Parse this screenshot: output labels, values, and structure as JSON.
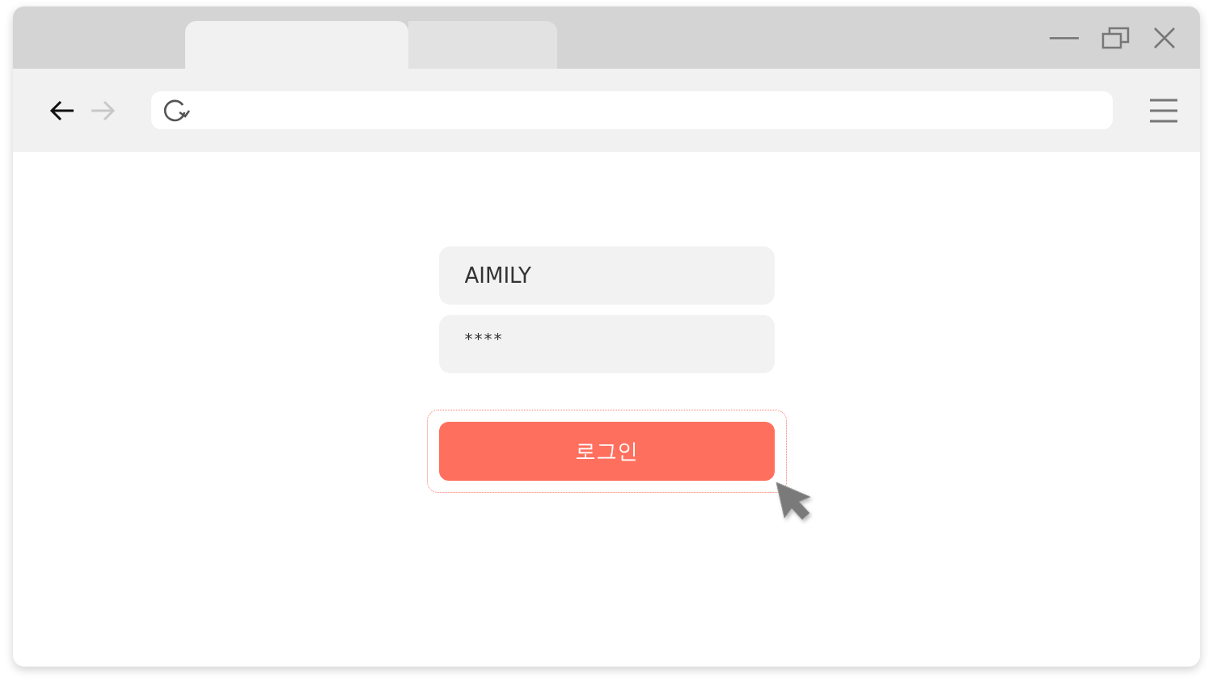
{
  "tabs": [
    {
      "selected": true
    },
    {
      "selected": false
    }
  ],
  "navigation": {
    "back_disabled": false,
    "forward_disabled": true
  },
  "login_form": {
    "username": {
      "value": "AIMILY"
    },
    "password": {
      "value": "****"
    },
    "login_button": {
      "label": "로그인",
      "focused": true
    }
  }
}
